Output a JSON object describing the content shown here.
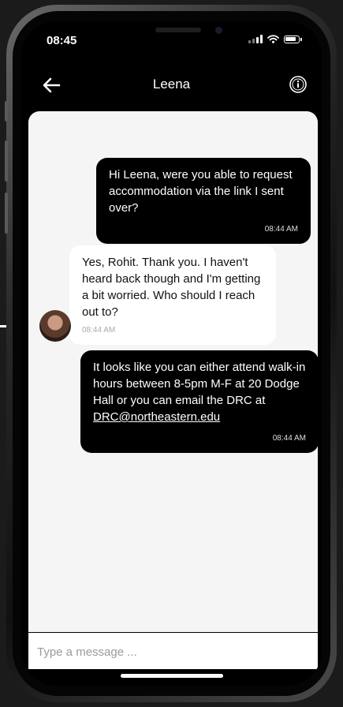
{
  "status_bar": {
    "time": "08:45"
  },
  "header": {
    "contact_name": "Leena",
    "back_icon": "arrow-left-icon",
    "info_icon": "info-icon"
  },
  "messages": [
    {
      "direction": "outgoing",
      "text": "Hi Leena, were you able to request accommodation via the link I sent over?",
      "time": "08:44 AM"
    },
    {
      "direction": "incoming",
      "text": "Yes, Rohit.  Thank you.  I haven't heard back though and I'm getting a bit worried.  Who should I reach out to?",
      "time": "08:44 AM"
    },
    {
      "direction": "outgoing",
      "text": "It looks like you can either attend walk-in hours between 8-5pm M-F at 20 Dodge Hall or you can email the DRC at ",
      "link": "DRC@northeastern.edu",
      "time": "08:44 AM"
    }
  ],
  "composer": {
    "placeholder": "Type a message ..."
  },
  "colors": {
    "outgoing_bubble": "#000000",
    "incoming_bubble": "#ffffff",
    "chat_background": "#f5f5f5"
  }
}
